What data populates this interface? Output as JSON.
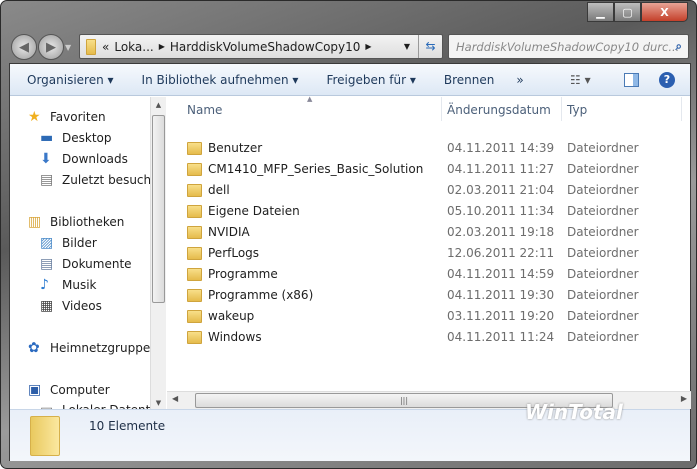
{
  "window": {
    "minimize": "▁",
    "maximize": "▢",
    "close": "X"
  },
  "address": {
    "overflow": "«",
    "crumbs": [
      "Loka...",
      "HarddiskVolumeShadowCopy10"
    ]
  },
  "search": {
    "placeholder": "HarddiskVolumeShadowCopy10 durc..."
  },
  "toolbar": {
    "organize": "Organisieren ▾",
    "library": "In Bibliothek aufnehmen ▾",
    "share": "Freigeben für ▾",
    "burn": "Brennen",
    "more": "»"
  },
  "nav": [
    {
      "label": "Favoriten",
      "icon": "star-icon"
    },
    {
      "label": "Desktop",
      "icon": "desktop-icon"
    },
    {
      "label": "Downloads",
      "icon": "downloads-icon"
    },
    {
      "label": "Zuletzt besucht",
      "icon": "recent-icon"
    },
    {
      "label": "Bibliotheken",
      "icon": "library-icon"
    },
    {
      "label": "Bilder",
      "icon": "pictures-icon"
    },
    {
      "label": "Dokumente",
      "icon": "documents-icon"
    },
    {
      "label": "Musik",
      "icon": "music-icon"
    },
    {
      "label": "Videos",
      "icon": "videos-icon"
    },
    {
      "label": "Heimnetzgruppe",
      "icon": "homegroup-icon"
    },
    {
      "label": "Computer",
      "icon": "computer-icon"
    },
    {
      "label": "Lokaler Datenträ",
      "icon": "drive-icon"
    }
  ],
  "columns": {
    "name": "Name",
    "date": "Änderungsdatum",
    "type": "Typ"
  },
  "files": [
    {
      "name": "Benutzer",
      "date": "04.11.2011 14:39",
      "type": "Dateiordner"
    },
    {
      "name": "CM1410_MFP_Series_Basic_Solution",
      "date": "04.11.2011 11:27",
      "type": "Dateiordner"
    },
    {
      "name": "dell",
      "date": "02.03.2011 21:04",
      "type": "Dateiordner"
    },
    {
      "name": "Eigene Dateien",
      "date": "05.10.2011 11:34",
      "type": "Dateiordner"
    },
    {
      "name": "NVIDIA",
      "date": "02.03.2011 19:18",
      "type": "Dateiordner"
    },
    {
      "name": "PerfLogs",
      "date": "12.06.2011 22:11",
      "type": "Dateiordner"
    },
    {
      "name": "Programme",
      "date": "04.11.2011 14:59",
      "type": "Dateiordner"
    },
    {
      "name": "Programme (x86)",
      "date": "04.11.2011 19:30",
      "type": "Dateiordner"
    },
    {
      "name": "wakeup",
      "date": "03.11.2011 19:20",
      "type": "Dateiordner"
    },
    {
      "name": "Windows",
      "date": "04.11.2011 11:24",
      "type": "Dateiordner"
    }
  ],
  "status": {
    "count": "10 Elemente"
  },
  "watermark": "WinTotal"
}
